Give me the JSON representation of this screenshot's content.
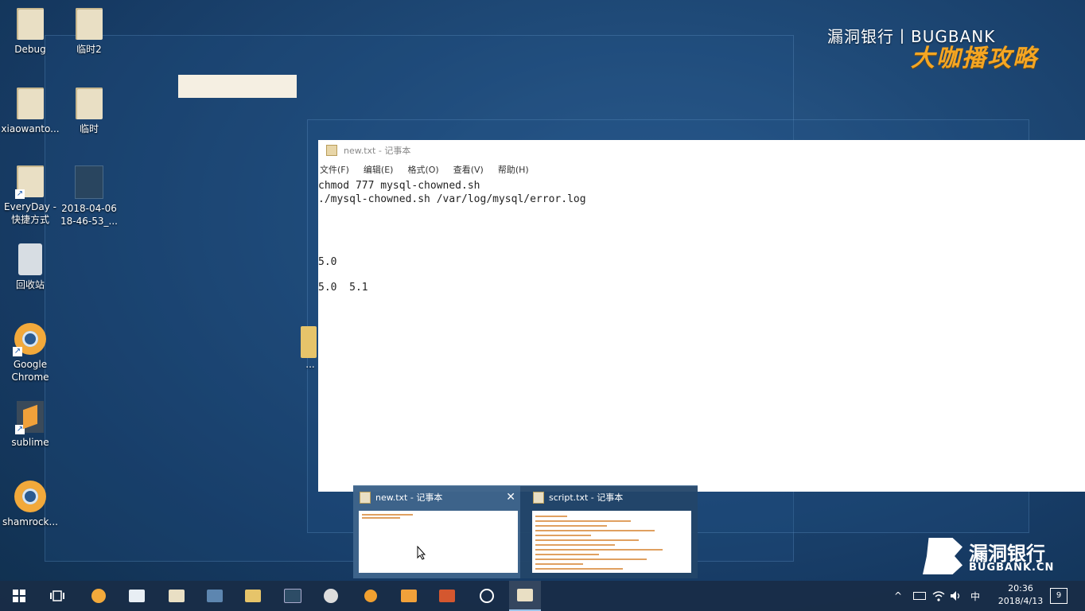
{
  "desktop": {
    "icons": [
      {
        "label": "Debug"
      },
      {
        "label": "临时2"
      },
      {
        "label": "xiaowanto..."
      },
      {
        "label": "临时"
      },
      {
        "label": "EveryDay -"
      },
      {
        "label": "快捷方式"
      },
      {
        "label": "2018-04-06"
      },
      {
        "label": "18-46-53_..."
      },
      {
        "label": "回收站"
      },
      {
        "label": "Google"
      },
      {
        "label": "Chrome"
      },
      {
        "label": "sublime"
      },
      {
        "label": "shamrock..."
      },
      {
        "label": "..."
      }
    ]
  },
  "watermark": {
    "top": "漏洞银行丨BUGBANK",
    "slogan": "大咖播攻略"
  },
  "notepad": {
    "title": "new.txt - 记事本",
    "menu": [
      "文件(F)",
      "编辑(E)",
      "格式(O)",
      "查看(V)",
      "帮助(H)"
    ],
    "lines": [
      "chmod 777 mysql-chowned.sh",
      "./mysql-chowned.sh /var/log/mysql/error.log",
      "5.0",
      "5.0  5.1"
    ]
  },
  "thumbnails": [
    {
      "title": "new.txt - 记事本",
      "close": "✕"
    },
    {
      "title": "script.txt - 记事本"
    }
  ],
  "logo": {
    "cn": "漏洞银行",
    "en": "BUGBANK.CN"
  },
  "taskbar": {
    "apps": [
      {
        "icon": "start-icon"
      },
      {
        "icon": "task-view-icon"
      },
      {
        "icon": "chrome-icon"
      },
      {
        "icon": "mail-icon"
      },
      {
        "icon": "file-icon"
      },
      {
        "icon": "tool-icon"
      },
      {
        "icon": "folder-icon"
      },
      {
        "icon": "image-icon"
      },
      {
        "icon": "clock-app-icon"
      },
      {
        "icon": "search-app-icon"
      },
      {
        "icon": "sublime-icon"
      },
      {
        "icon": "powerpoint-icon"
      },
      {
        "icon": "capture-icon"
      },
      {
        "icon": "notepad-icon"
      }
    ],
    "tray": {
      "chevron": "^",
      "ime": "中",
      "time": "20:36",
      "date": "2018/4/13",
      "notification_count": "9"
    }
  }
}
